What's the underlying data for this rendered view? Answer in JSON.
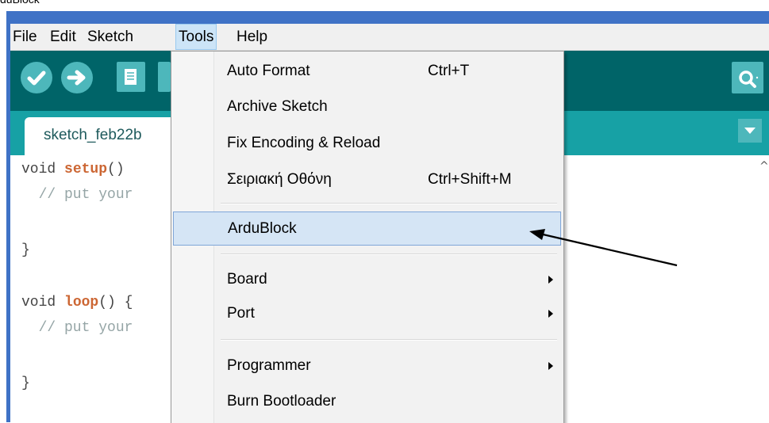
{
  "caption": "duBlock",
  "menubar": {
    "items": [
      "File",
      "Edit",
      "Sketch",
      "Tools",
      "Help"
    ],
    "active": "Tools"
  },
  "toolbar": {
    "buttons": [
      "verify-icon",
      "upload-icon",
      "new-icon",
      "open-icon",
      "serial-monitor-icon"
    ]
  },
  "tab": {
    "label": "sketch_feb22b"
  },
  "editor": {
    "lines": [
      {
        "kw_before": "void ",
        "keyword": "setup",
        "rest": "()"
      },
      {
        "comment": "  // put your"
      },
      {
        "text": ""
      },
      {
        "text": "}"
      },
      {
        "text": ""
      },
      {
        "kw_before": "void ",
        "keyword": "loop",
        "rest": "() {"
      },
      {
        "comment": "  // put your"
      },
      {
        "text": ""
      },
      {
        "text": "}"
      }
    ]
  },
  "tools_menu": {
    "items": [
      {
        "label": "Auto Format",
        "shortcut": "Ctrl+T"
      },
      {
        "label": "Archive Sketch",
        "shortcut": ""
      },
      {
        "label": "Fix Encoding & Reload",
        "shortcut": ""
      },
      {
        "label": "Σειριακή Οθόνη",
        "shortcut": "Ctrl+Shift+M"
      },
      {
        "label": "ArduBlock",
        "shortcut": "",
        "highlighted": true
      },
      {
        "label": "Board",
        "submenu": true
      },
      {
        "label": "Port",
        "submenu": true
      },
      {
        "label": "Programmer",
        "submenu": true
      },
      {
        "label": "Burn Bootloader",
        "shortcut": ""
      }
    ]
  },
  "colors": {
    "toolbar": "#006468",
    "tabbar": "#17a1a5",
    "button": "#4db7bb",
    "keyword": "#cc6633",
    "highlight": "#d5e5f5"
  }
}
